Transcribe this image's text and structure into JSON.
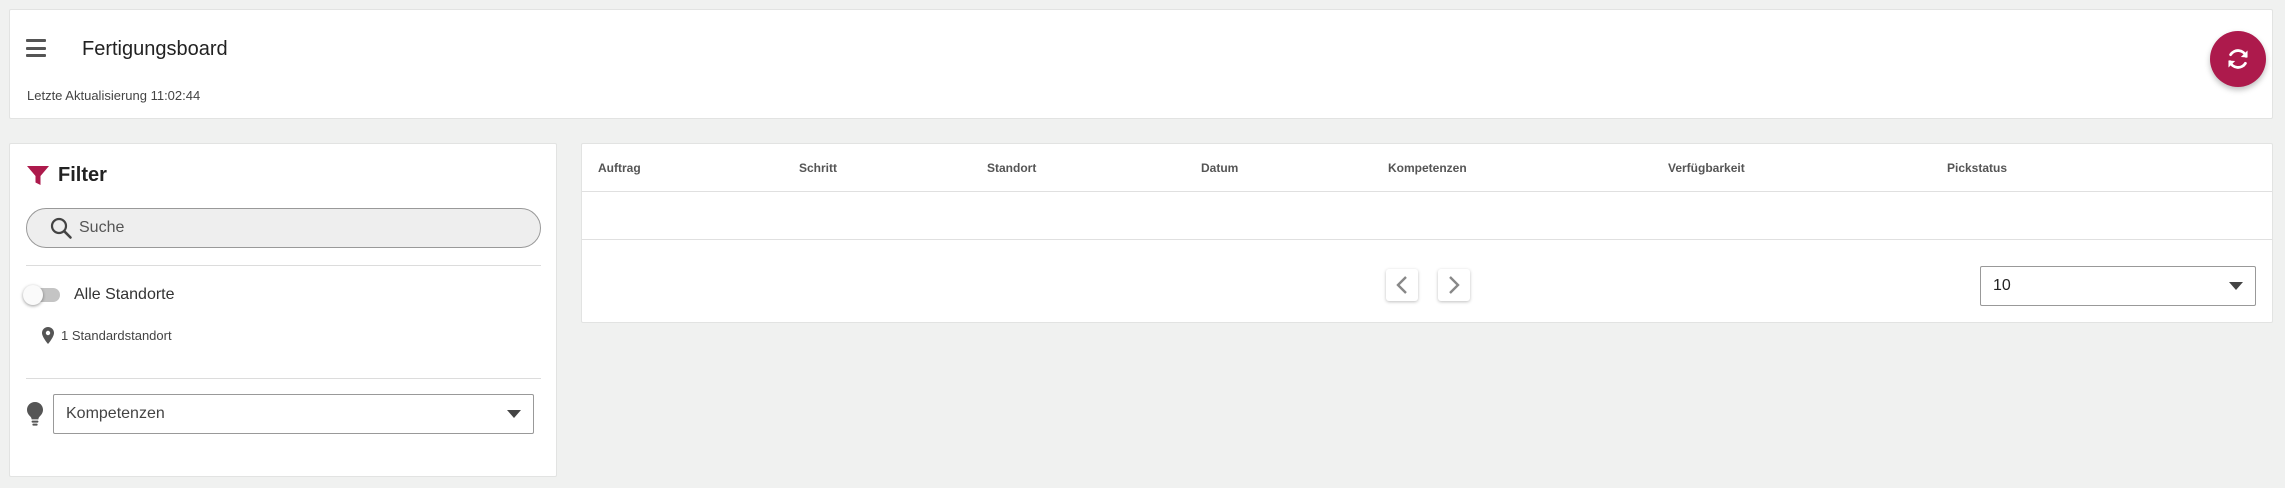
{
  "header": {
    "title": "Fertigungsboard",
    "last_update_label": "Letzte Aktualisierung 11:02:44",
    "menu_icon": "hamburger-menu-icon",
    "refresh_icon": "refresh-icon",
    "accent_color": "#ad1a4c"
  },
  "filter": {
    "title": "Filter",
    "icon": "funnel-icon",
    "icon_color": "#ad1a4c",
    "search": {
      "placeholder": "Suche",
      "value": ""
    },
    "all_locations": {
      "label": "Alle Standorte",
      "enabled": false
    },
    "default_location": {
      "label": "1 Standardstandort",
      "icon": "map-pin-icon"
    },
    "competences": {
      "label": "Kompetenzen",
      "icon": "lightbulb-icon"
    }
  },
  "table": {
    "columns": [
      "Auftrag",
      "Schritt",
      "Standort",
      "Datum",
      "Kompetenzen",
      "Verfügbarkeit",
      "Pickstatus"
    ],
    "rows": [],
    "pagination": {
      "prev_icon": "chevron-left-icon",
      "next_icon": "chevron-right-icon",
      "page_size": "10"
    }
  }
}
